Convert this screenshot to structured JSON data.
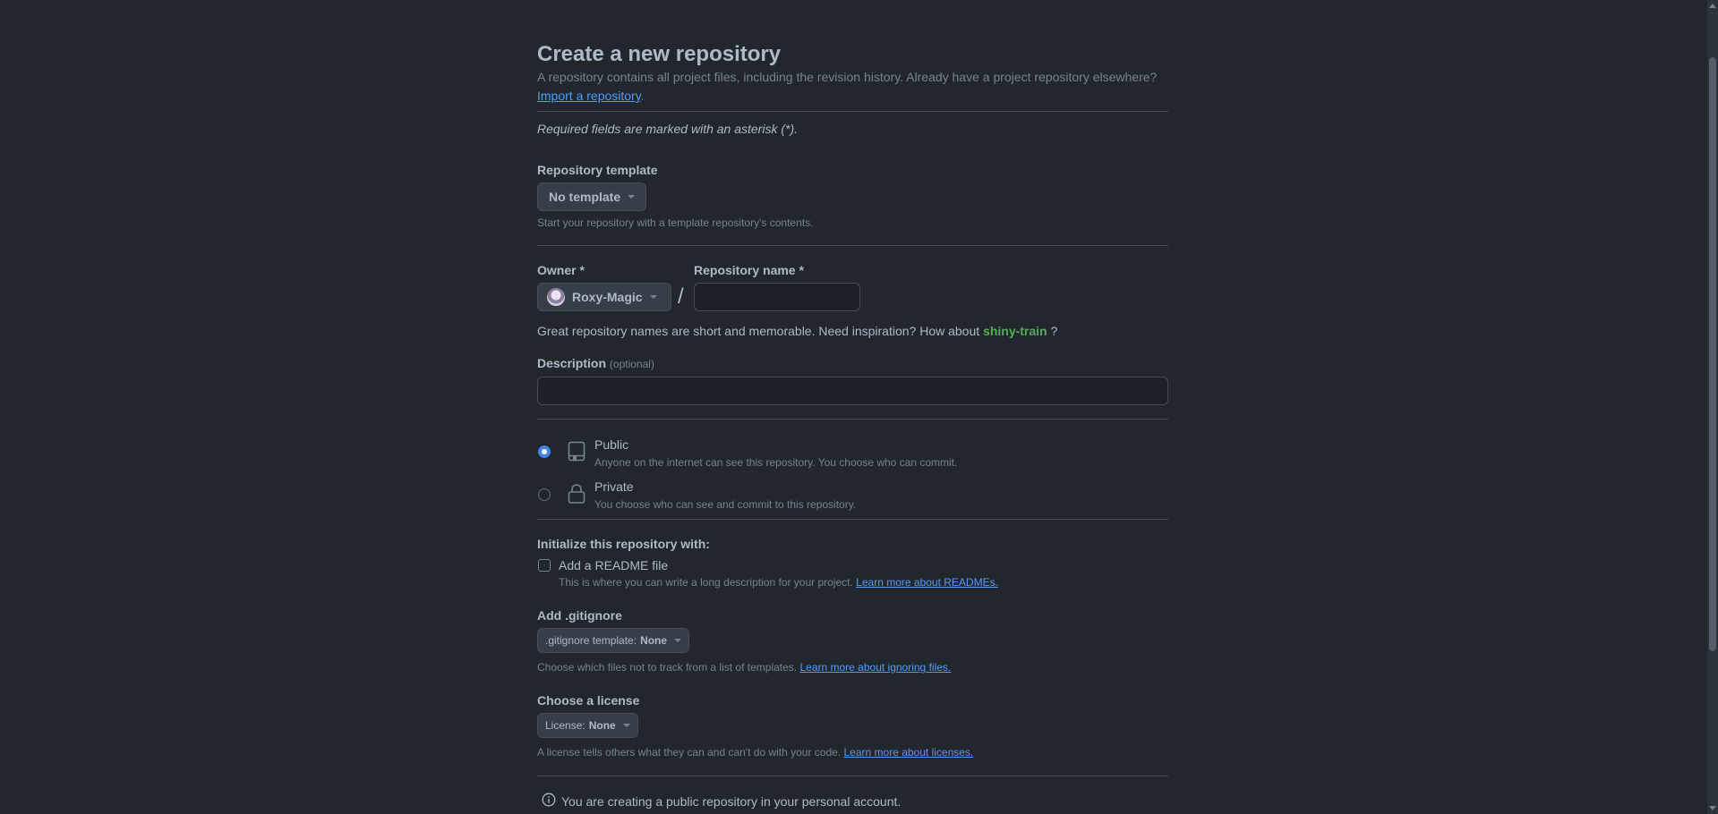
{
  "header": {
    "title": "Create a new repository",
    "subtitle": "A repository contains all project files, including the revision history. Already have a project repository elsewhere?",
    "import_link": "Import a repository",
    "import_suffix": "."
  },
  "required_note": "Required fields are marked with an asterisk (*).",
  "template": {
    "label": "Repository template",
    "button": "No template",
    "note": "Start your repository with a template repository's contents."
  },
  "owner": {
    "label": "Owner *",
    "value": "Roxy-Magic",
    "separator": "/"
  },
  "repo_name": {
    "label": "Repository name *",
    "value": "",
    "placeholder": ""
  },
  "suggestion": {
    "prefix": "Great repository names are short and memorable. Need inspiration? How about",
    "name": "shiny-train",
    "suffix": "?"
  },
  "description": {
    "label": "Description",
    "optional": "(optional)",
    "value": ""
  },
  "visibility": {
    "public": {
      "title": "Public",
      "desc": "Anyone on the internet can see this repository. You choose who can commit.",
      "checked": true
    },
    "private": {
      "title": "Private",
      "desc": "You choose who can see and commit to this repository.",
      "checked": false
    }
  },
  "init": {
    "heading": "Initialize this repository with:",
    "readme_label": "Add a README file",
    "readme_note": "This is where you can write a long description for your project.",
    "readme_link": "Learn more about READMEs."
  },
  "gitignore": {
    "heading": "Add .gitignore",
    "button_prefix": ".gitignore template:",
    "button_value": "None",
    "note": "Choose which files not to track from a list of templates.",
    "link": "Learn more about ignoring files."
  },
  "license": {
    "heading": "Choose a license",
    "button_prefix": "License:",
    "button_value": "None",
    "note": "A license tells others what they can and can't do with your code.",
    "link": "Learn more about licenses."
  },
  "footer_info": "You are creating a public repository in your personal account.",
  "colors": {
    "background": "#22272e",
    "accent_link": "#539bf5",
    "suggestion_green": "#57ab5a",
    "radio_checked": "#4184e4"
  },
  "icons": {
    "template_caret": "chevron-down-icon",
    "public_repo": "repo-icon",
    "private_repo": "lock-icon",
    "info": "info-icon"
  }
}
